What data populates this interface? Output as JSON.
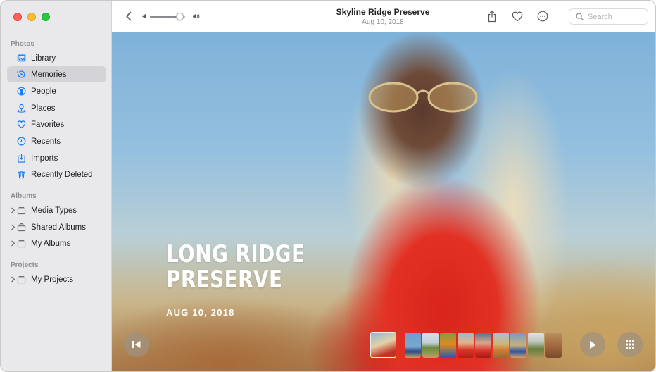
{
  "window": {
    "title": "Skyline Ridge Preserve",
    "subtitle": "Aug 10, 2018"
  },
  "sidebar": {
    "sections": {
      "photos": "Photos",
      "albums": "Albums",
      "projects": "Projects"
    },
    "photos_items": [
      {
        "label": "Library",
        "icon": "library-icon"
      },
      {
        "label": "Memories",
        "icon": "memories-icon",
        "selected": true
      },
      {
        "label": "People",
        "icon": "people-icon"
      },
      {
        "label": "Places",
        "icon": "places-icon"
      },
      {
        "label": "Favorites",
        "icon": "heart-icon"
      },
      {
        "label": "Recents",
        "icon": "clock-icon"
      },
      {
        "label": "Imports",
        "icon": "import-icon"
      },
      {
        "label": "Recently Deleted",
        "icon": "trash-icon"
      }
    ],
    "album_items": [
      {
        "label": "Media Types",
        "icon": "album-stack-icon"
      },
      {
        "label": "Shared Albums",
        "icon": "shared-album-icon"
      },
      {
        "label": "My Albums",
        "icon": "album-stack-icon"
      }
    ],
    "project_items": [
      {
        "label": "My Projects",
        "icon": "album-stack-icon"
      }
    ]
  },
  "toolbar": {
    "volume_level": 0.85,
    "search_placeholder": "Search",
    "icons": [
      "back-icon",
      "volume-low-icon",
      "volume-high-icon",
      "share-icon",
      "heart-icon",
      "more-icon",
      "search-icon"
    ]
  },
  "memory": {
    "title": "LONG RIDGE PRESERVE",
    "date": "AUG 10, 2018"
  },
  "filmstrip": {
    "thumb_count": 10,
    "current_index": 0
  },
  "colors": {
    "accent": "#0a7aff",
    "sidebar_bg": "#e9e9ec",
    "selected_row": "#d4d4d8",
    "control_bg": "#a0917d"
  }
}
